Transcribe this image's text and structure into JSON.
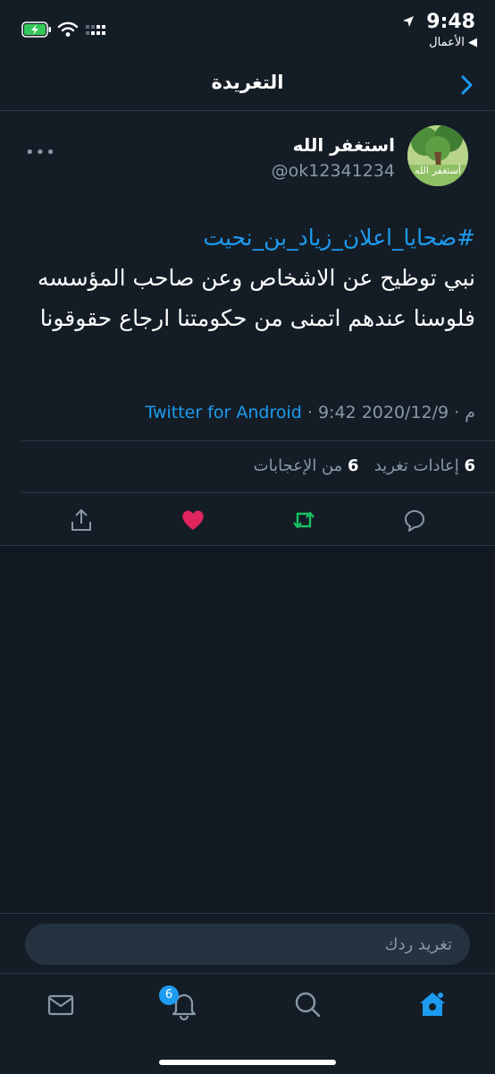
{
  "status_bar": {
    "time": "9:48",
    "back_app": "◀ الأعمال",
    "icons": [
      "battery-charging-icon",
      "wifi-icon",
      "cellular-signal-icon",
      "location-arrow-icon"
    ]
  },
  "header": {
    "title": "التغريدة",
    "back_icon": "chevron-left-icon"
  },
  "tweet": {
    "display_name": "استغفر الله",
    "handle": "@ok12341234",
    "avatar_text": "أستغفر الله",
    "hashtag": "#ضحايا_اعلان_زياد_بن_نحيت",
    "text": "نبي توظيح عن الاشخاص وعن صاحب المؤسسه فلوسنا عندهم اتمنى من حكومتنا ارجاع حقوقونا",
    "date": "2020/12/9",
    "time": "9:42 م",
    "source": "Twitter for Android",
    "separator": " · "
  },
  "stats": {
    "retweets_count": "6",
    "retweets_label": "إعادات تغريد",
    "likes_count": "6",
    "likes_label": "من الإعجابات"
  },
  "actions": [
    "reply-icon",
    "retweet-icon",
    "like-icon",
    "share-icon"
  ],
  "reply": {
    "placeholder": "تغريد ردك"
  },
  "tabbar": {
    "items": [
      "home-icon",
      "search-icon",
      "notifications-icon",
      "messages-icon"
    ],
    "notifications_badge": "6"
  },
  "colors": {
    "background": "#141d26",
    "accent": "#1d9bf0",
    "retweet": "#17bf63",
    "like": "#e0245e",
    "muted": "#8899a6"
  }
}
